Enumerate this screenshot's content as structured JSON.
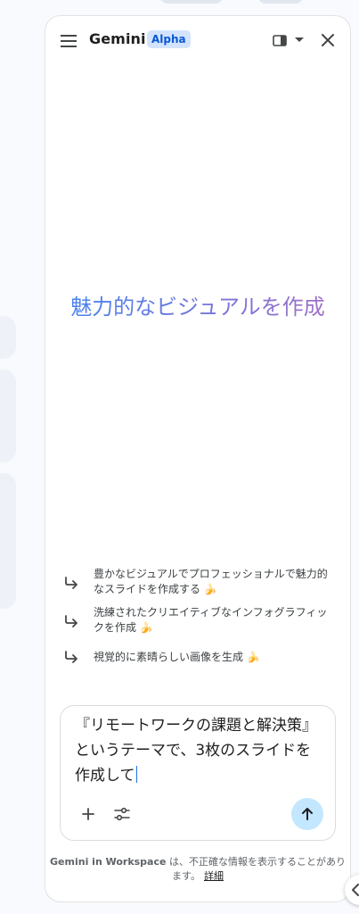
{
  "header": {
    "title": "Gemini",
    "badge": "Alpha",
    "icons": [
      "menu-icon",
      "side-panel-icon",
      "caret-down-icon",
      "close-icon"
    ]
  },
  "hero": {
    "text": "魅力的なビジュアルを作成"
  },
  "suggestions": [
    {
      "label": "豊かなビジュアルでプロフェッショナルで魅力的なスライドを作成する 🍌",
      "icon": "return-arrow-icon"
    },
    {
      "label": "洗練されたクリエイティブなインフォグラフィックを作成 🍌",
      "icon": "return-arrow-icon"
    },
    {
      "label": "視覚的に素晴らしい画像を生成 🍌",
      "icon": "return-arrow-icon"
    }
  ],
  "prompt": {
    "value": "『リモートワークの課題と解決策』というテーマで、3枚のスライドを作成して",
    "icons": [
      "add-icon",
      "tools-icon",
      "send-arrow-icon"
    ]
  },
  "footer": {
    "brand": "Gemini in Workspace",
    "disclaimer_rest": " は、不正確な情報を表示することがあります。",
    "details_link": "詳細"
  },
  "colors": {
    "accent": "#0b57d0",
    "badge_bg": "#d3e3fd",
    "send_bg": "#c2e7ff",
    "hero_gradient_start": "#4285f4",
    "hero_gradient_end": "#a872c4"
  }
}
